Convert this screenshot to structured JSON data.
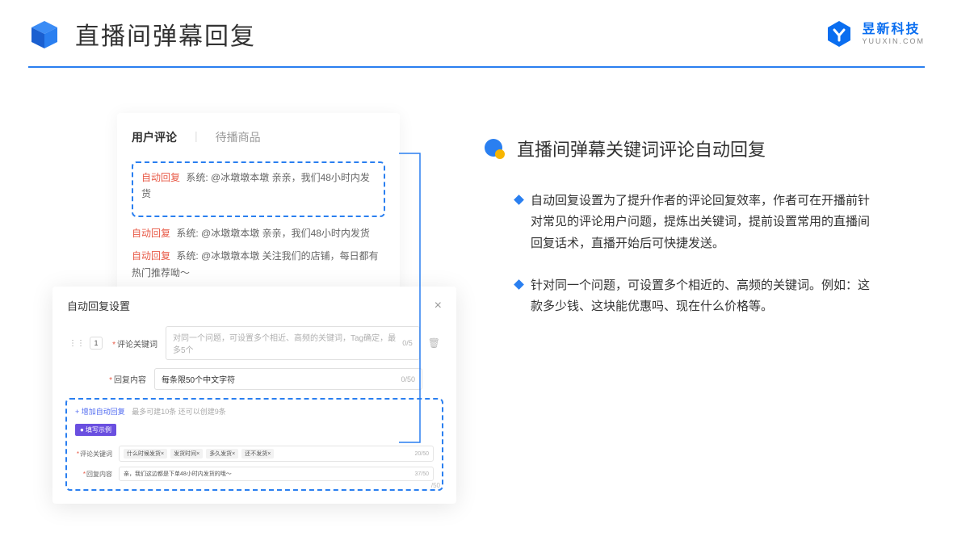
{
  "header": {
    "title": "直播间弹幕回复",
    "brand_cn": "昱新科技",
    "brand_en": "YUUXIN.COM"
  },
  "comment_card": {
    "tab_active": "用户评论",
    "tab_inactive": "待播商品",
    "highlight_prefix": "自动回复",
    "highlight_sys": "系统:",
    "highlight_text": "@冰墩墩本墩 亲亲，我们48小时内发货",
    "row2_prefix": "自动回复",
    "row2_sys": "系统:",
    "row2_text": "@冰墩墩本墩 亲亲，我们48小时内发货",
    "row3_prefix": "自动回复",
    "row3_sys": "系统:",
    "row3_text": "@冰墩墩本墩 关注我们的店铺，每日都有热门推荐呦～"
  },
  "modal": {
    "title": "自动回复设置",
    "idx": "1",
    "label_keywords": "评论关键词",
    "placeholder_keywords": "对同一个问题，可设置多个相近、高频的关键词，Tag确定，最多5个",
    "count_keywords": "0/5",
    "label_content": "回复内容",
    "placeholder_content": "每条限50个中文字符",
    "count_content": "0/50",
    "add_text": "+ 增加自动回复",
    "add_hint": "最多可建10条 还可以创建9条",
    "example_badge": "● 填写示例",
    "ex_label_keywords": "评论关键词",
    "ex_tags": [
      "什么时候发货×",
      "发货时间×",
      "多久发货×",
      "还不发货×"
    ],
    "ex_kw_count": "20/50",
    "ex_label_content": "回复内容",
    "ex_content_text": "亲，我们这边都是下单48小时内发货的哦～",
    "ex_content_count": "37/50",
    "trailing_count": "/50"
  },
  "right": {
    "heading": "直播间弹幕关键词评论自动回复",
    "b1": "自动回复设置为了提升作者的评论回复效率，作者可在开播前针对常见的评论用户问题，提炼出关键词，提前设置常用的直播间回复话术，直播开始后可快捷发送。",
    "b2": "针对同一个问题，可设置多个相近的、高频的关键词。例如：这款多少钱、这块能优惠吗、现在什么价格等。"
  }
}
